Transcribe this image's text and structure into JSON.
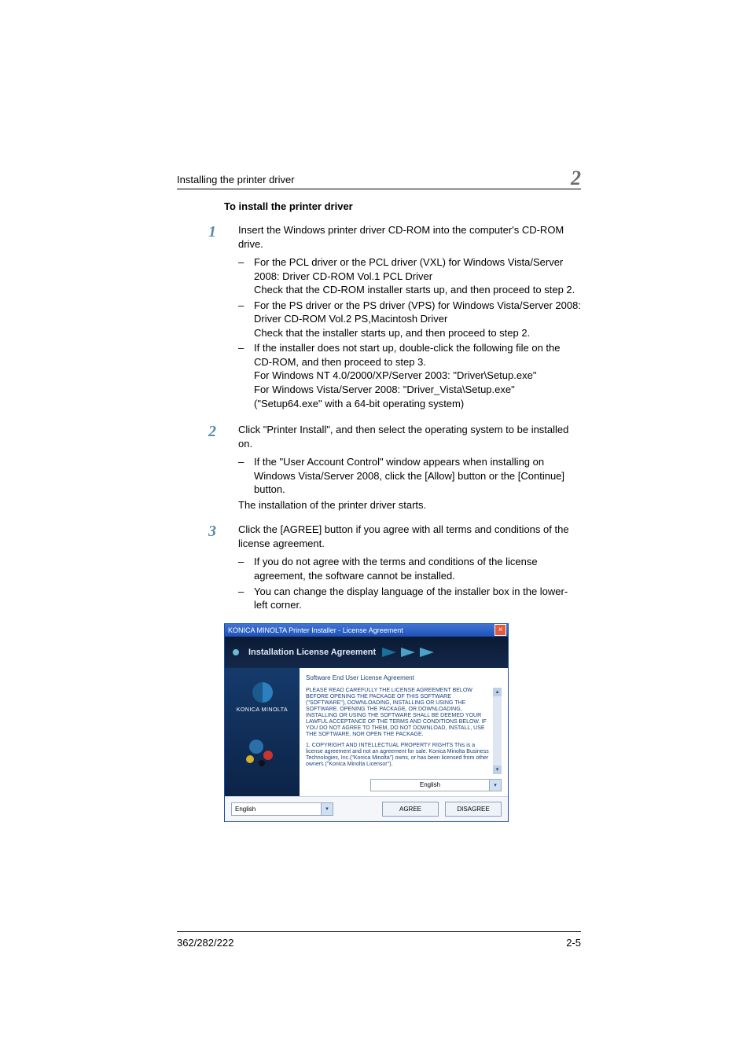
{
  "header": {
    "running_title": "Installing the printer driver",
    "chapter_number": "2"
  },
  "footer": {
    "model": "362/282/222",
    "page": "2-5"
  },
  "section_title": "To install the printer driver",
  "steps": {
    "s1": {
      "num": "1",
      "lead": "Insert the Windows printer driver CD-ROM into the computer's CD-ROM drive.",
      "b1": {
        "dash": "–",
        "l1": "For the PCL driver or the PCL driver (VXL) for Windows Vista/Server 2008: Driver CD-ROM Vol.1 PCL Driver",
        "l2": "Check that the CD-ROM installer starts up, and then proceed to step 2."
      },
      "b2": {
        "dash": "–",
        "l1": "For the PS driver or the PS driver (VPS) for Windows Vista/Server 2008: Driver CD-ROM Vol.2 PS,Macintosh Driver",
        "l2": "Check that the installer starts up, and then proceed to step 2."
      },
      "b3": {
        "dash": "–",
        "l1": "If the installer does not start up, double-click the following file on the CD-ROM, and then proceed to step 3.",
        "l2": "For Windows NT 4.0/2000/XP/Server 2003: \"Driver\\Setup.exe\"",
        "l3": "For Windows Vista/Server 2008: \"Driver_Vista\\Setup.exe\" (\"Setup64.exe\" with a 64-bit operating system)"
      }
    },
    "s2": {
      "num": "2",
      "lead": "Click \"Printer Install\", and then select the operating system to be installed on.",
      "b1": {
        "dash": "–",
        "l1": "If the \"User Account Control\" window appears when installing on Windows Vista/Server 2008, click the [Allow] button or the [Continue] button."
      },
      "tail": "The installation of the printer driver starts."
    },
    "s3": {
      "num": "3",
      "lead": "Click the [AGREE] button if you agree with all terms and conditions of the license agreement.",
      "b1": {
        "dash": "–",
        "l1": "If you do not agree with the terms and conditions of the license agreement, the software cannot be installed."
      },
      "b2": {
        "dash": "–",
        "l1": "You can change the display language of the installer box in the lower-left corner."
      }
    }
  },
  "dialog": {
    "title": "KONICA MINOLTA Printer Installer - License Agreement",
    "close": "×",
    "banner": "Installation License Agreement",
    "brand": "KONICA MINOLTA",
    "eula_heading": "Software End User License Agreement",
    "eula_p1": "PLEASE READ CAREFULLY THE LICENSE AGREEMENT BELOW BEFORE OPENING THE PACKAGE OF THIS SOFTWARE (\"SOFTWARE\"), DOWNLOADING, INSTALLING OR USING THE SOFTWARE. OPENING THE PACKAGE, OR DOWNLOADING, INSTALLING OR USING THE SOFTWARE SHALL BE DEEMED YOUR LAWFUL ACCEPTANCE OF THE TERMS AND CONDITIONS BELOW. IF YOU DO NOT AGREE TO THEM, DO NOT DOWNLOAD, INSTALL, USE THE SOFTWARE, NOR OPEN THE PACKAGE.",
    "eula_p2": "1. COPYRIGHT AND INTELLECTUAL PROPERTY RIGHTS\nThis is a license agreement and not an agreement for sale. Konica Minolta Business Technologies, Inc.(\"Konica Minolta\") owns, or has been licensed from other owners (\"Konica Minolta Licensor\"),",
    "inner_lang": "English",
    "footer_lang": "English",
    "agree": "AGREE",
    "disagree": "DISAGREE"
  }
}
